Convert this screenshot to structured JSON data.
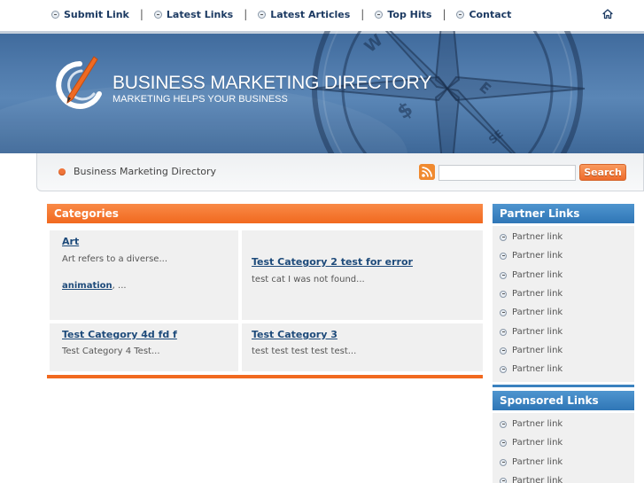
{
  "topnav": {
    "items": [
      "Submit Link",
      "Latest Links",
      "Latest Articles",
      "Top Hits",
      "Contact"
    ],
    "home_icon": "home-icon"
  },
  "banner": {
    "title": "BUSINESS MARKETING DIRECTORY",
    "tagline": "MARKETING HELPS YOUR BUSINESS",
    "colors": {
      "dark": "#3f6a9c",
      "light": "#5a86b6"
    }
  },
  "subbar": {
    "breadcrumb": "Business Marketing Directory",
    "search": {
      "placeholder": "",
      "value": "",
      "button_label": "Search"
    }
  },
  "categories": {
    "header": "Categories",
    "cells": [
      {
        "title": "Art",
        "description": "Art refers to a diverse...",
        "sub_link": "animation",
        "sub_suffix": ", ..."
      },
      {
        "title": "Test Category 2 test for error",
        "description": "test cat I was not found..."
      },
      {
        "title": "Test Category 4d fd f",
        "description": "Test Category 4 Test..."
      },
      {
        "title": "Test Category 3",
        "description": "test test test test test..."
      }
    ],
    "accent": "#f1691f"
  },
  "partner_links": {
    "header": "Partner Links",
    "items": [
      "Partner link",
      "Partner link",
      "Partner link",
      "Partner link",
      "Partner link",
      "Partner link",
      "Partner link",
      "Partner link"
    ]
  },
  "sponsored_links": {
    "header": "Sponsored Links",
    "items": [
      "Partner link",
      "Partner link",
      "Partner link",
      "Partner link"
    ]
  }
}
